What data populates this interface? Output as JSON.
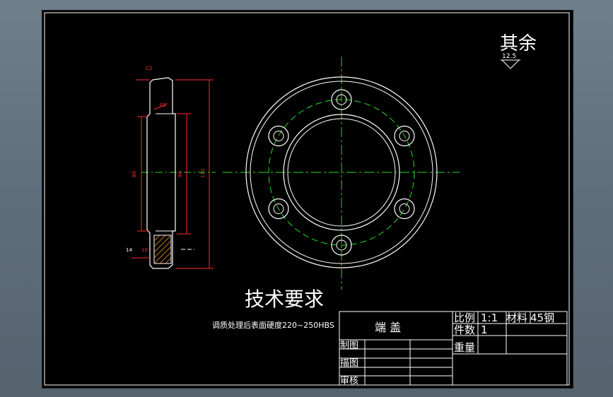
{
  "surface_note": {
    "label": "其余",
    "roughness": "12.5"
  },
  "section_view": {
    "chamfer_top": "C2",
    "chamfer_inner": "C2",
    "dim_d1": "80",
    "dim_d2": "90",
    "dim_d3": "110",
    "dim_t": "14",
    "dim_s": "10"
  },
  "technical_requirements": {
    "heading": "技术要求",
    "item": "调质处理后表面硬度220~250HBS"
  },
  "title_block": {
    "part_name": "端  盖",
    "scale_label": "比例",
    "scale_value": "1:1",
    "material_label": "材料",
    "material_value": "45钢",
    "quantity_label": "件数",
    "quantity_value": "1",
    "weight_label": "重量",
    "drawn_label": "制图",
    "traced_label": "描图",
    "checked_label": "审核"
  },
  "colors": {
    "outline": "#ffffff",
    "dimension": "#ff2a2a",
    "centerline": "#22dd22",
    "background": "#000000"
  }
}
